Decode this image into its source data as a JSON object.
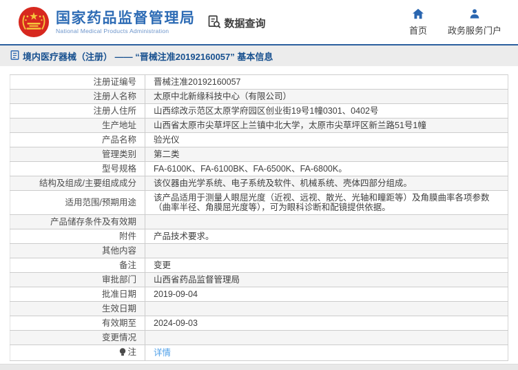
{
  "header": {
    "title_cn": "国家药品监督管理局",
    "title_en": "National Medical Products Administration",
    "data_query_label": "数据查询",
    "nav_home_label": "首页",
    "nav_portal_label": "政务服务门户"
  },
  "breadcrumb": {
    "text": "境内医疗器械（注册） —— “晋械注准20192160057” 基本信息"
  },
  "table": {
    "rows": [
      {
        "label": "注册证编号",
        "value": "晋械注准20192160057"
      },
      {
        "label": "注册人名称",
        "value": "太原中北新缘科技中心（有限公司）"
      },
      {
        "label": "注册人住所",
        "value": "山西综改示范区太原学府园区创业街19号1幢0301、0402号"
      },
      {
        "label": "生产地址",
        "value": "山西省太原市尖草坪区上兰镇中北大学，太原市尖草坪区新兰路51号1幢"
      },
      {
        "label": "产品名称",
        "value": "验光仪"
      },
      {
        "label": "管理类别",
        "value": "第二类"
      },
      {
        "label": "型号规格",
        "value": "FA-6100K、FA-6100BK、FA-6500K、FA-6800K。"
      },
      {
        "label": "结构及组成/主要组成成分",
        "value": "该仪器由光学系统、电子系统及软件、机械系统、壳体四部分组成。"
      },
      {
        "label": "适用范围/预期用途",
        "value": "该产品适用于测量人眼屈光度（近视、远视、散光、光轴和瞳距等）及角膜曲率各项参数（曲率半径、角膜屈光度等），可为眼科诊断和配镜提供依据。"
      },
      {
        "label": "产品储存条件及有效期",
        "value": ""
      },
      {
        "label": "附件",
        "value": "产品技术要求。"
      },
      {
        "label": "其他内容",
        "value": ""
      },
      {
        "label": "备注",
        "value": "变更"
      },
      {
        "label": "审批部门",
        "value": "山西省药品监督管理局"
      },
      {
        "label": "批准日期",
        "value": "2019-09-04"
      },
      {
        "label": "生效日期",
        "value": ""
      },
      {
        "label": "有效期至",
        "value": "2024-09-03"
      },
      {
        "label": "变更情况",
        "value": ""
      },
      {
        "label": "注",
        "value": "详情",
        "link": true,
        "note_icon": true
      }
    ]
  },
  "colors": {
    "brand_blue": "#2e6cb5",
    "brand_en_blue": "#6d95cb",
    "nav_icon_blue": "#2a66b0",
    "breadcrumb_text_blue": "#17508f",
    "breadcrumb_border_blue": "#2a5f9e",
    "breadcrumb_bg": "#ececec",
    "row_alt_bg": "#f5f5f5",
    "table_border": "#cccccc",
    "link_blue": "#4d9fe8",
    "emblem_red": "#d7281f",
    "emblem_gold": "#f5c63c"
  }
}
